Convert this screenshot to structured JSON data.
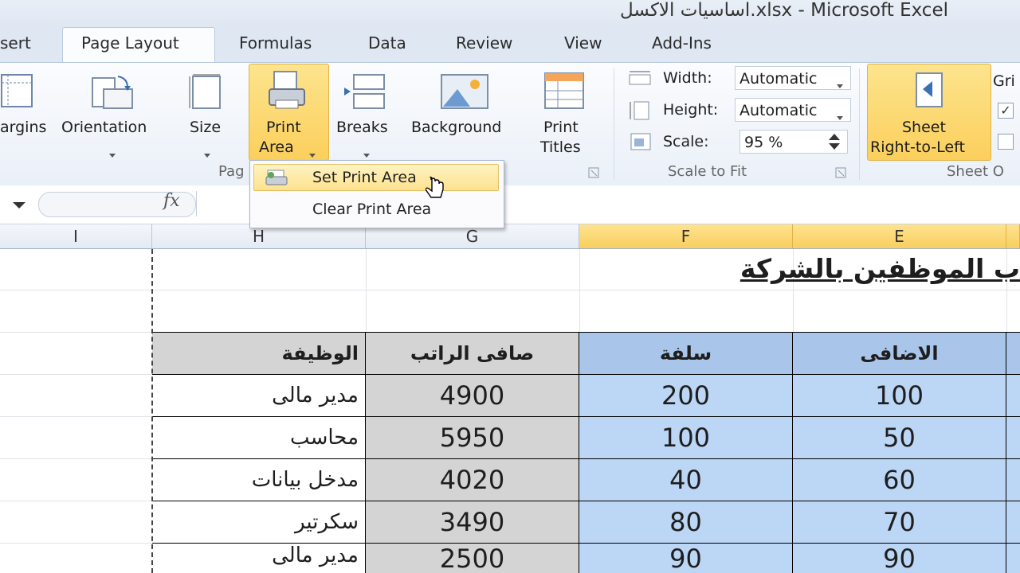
{
  "window": {
    "title": "اساسيات الاكسل.xlsx  -  Microsoft Excel"
  },
  "tabs": [
    {
      "label": "sert"
    },
    {
      "label": "Page Layout",
      "active": true
    },
    {
      "label": "Formulas"
    },
    {
      "label": "Data"
    },
    {
      "label": "Review"
    },
    {
      "label": "View"
    },
    {
      "label": "Add-Ins"
    }
  ],
  "ribbon": {
    "margins": "argins",
    "orientation": "Orientation",
    "size": "Size",
    "print_area_line1": "Print",
    "print_area_line2": "Area",
    "breaks": "Breaks",
    "background": "Background",
    "print_titles_line1": "Print",
    "print_titles_line2": "Titles",
    "page_setup_group": "Pag",
    "width_label": "Width:",
    "width_value": "Automatic",
    "height_label": "Height:",
    "height_value": "Automatic",
    "scale_label": "Scale:",
    "scale_value": "95 %",
    "scale_group": "Scale to Fit",
    "sheet_rtl_line1": "Sheet",
    "sheet_rtl_line2": "Right-to-Left",
    "gridlines": "Gri",
    "sheet_options_group": "Sheet O"
  },
  "print_area_menu": {
    "set": "Set Print Area",
    "clear": "Clear Print Area"
  },
  "formula_bar": {
    "fx": "fx",
    "value": ""
  },
  "columns": [
    "I",
    "H",
    "G",
    "F",
    "E"
  ],
  "sheet": {
    "title": "ب الموظفين بالشركة",
    "headers": {
      "job": "الوظيفة",
      "net_salary": "صافى الراتب",
      "advance": "سلفة",
      "extra": "الاضافى"
    },
    "rows": [
      {
        "job": "مدير مالى",
        "net_salary": "4900",
        "advance": "200",
        "extra": "100"
      },
      {
        "job": "محاسب",
        "net_salary": "5950",
        "advance": "100",
        "extra": "50"
      },
      {
        "job": "مدخل بيانات",
        "net_salary": "4020",
        "advance": "40",
        "extra": "60"
      },
      {
        "job": "سكرتير",
        "net_salary": "3490",
        "advance": "80",
        "extra": "70"
      },
      {
        "job": "مدير مالى",
        "net_salary": "2500",
        "advance": "90",
        "extra": "90"
      }
    ]
  },
  "colors": {
    "accent_yellow": "#fbd469",
    "header_gray": "#d4d4d4",
    "selection_blue": "#bcd6f5",
    "selection_header_blue": "#a9c6ea"
  }
}
